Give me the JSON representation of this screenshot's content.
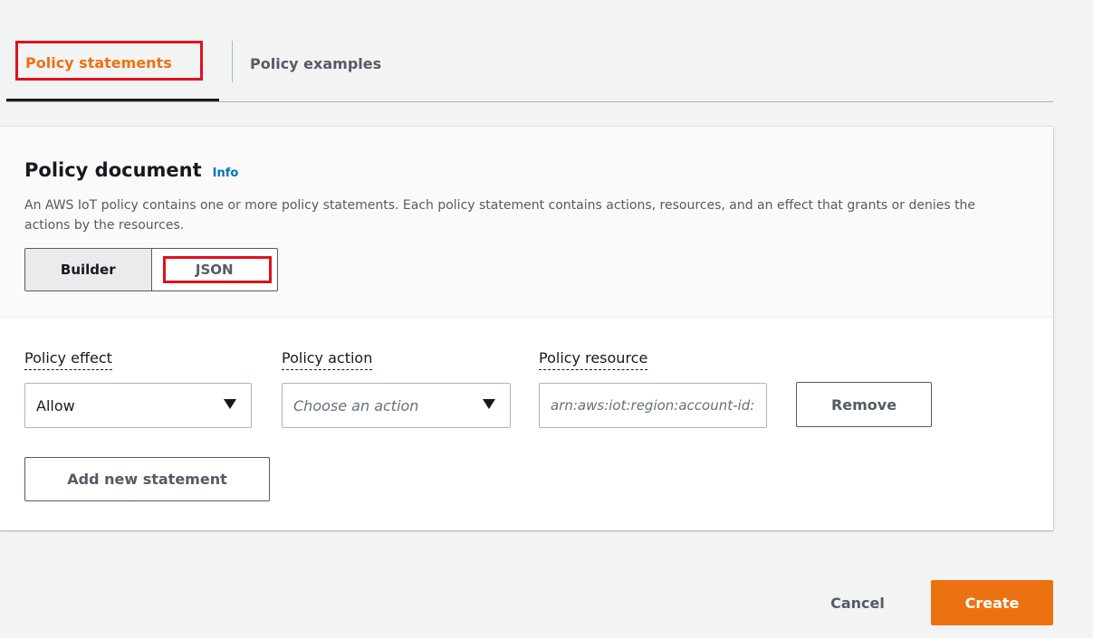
{
  "tabs": {
    "active_label": "Policy statements",
    "inactive_label": "Policy examples"
  },
  "policy_document": {
    "title": "Policy document",
    "info_label": "Info",
    "description": "An AWS IoT policy contains one or more policy statements. Each policy statement contains actions, resources, and an effect that grants or denies the actions by the resources.",
    "mode_options": [
      "Builder",
      "JSON"
    ],
    "selected_mode": "Builder"
  },
  "statement": {
    "effect_label": "Policy effect",
    "effect_value": "Allow",
    "action_label": "Policy action",
    "action_placeholder": "Choose an action",
    "resource_label": "Policy resource",
    "resource_placeholder": "arn:aws:iot:region:account-id:*",
    "remove_label": "Remove"
  },
  "add_statement_label": "Add new statement",
  "footer": {
    "cancel_label": "Cancel",
    "create_label": "Create"
  },
  "colors": {
    "accent_orange": "#ec7211",
    "link_blue": "#0073bb",
    "highlight_red": "#e0121c"
  },
  "icons": {
    "dropdown": "caret-down-icon"
  }
}
